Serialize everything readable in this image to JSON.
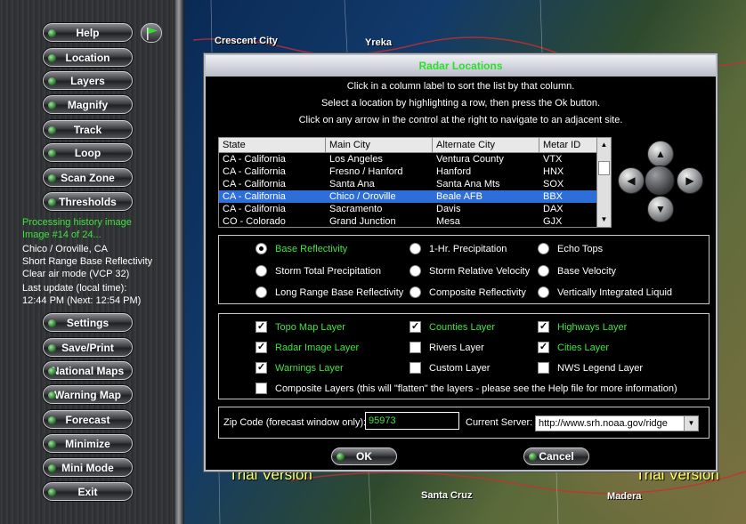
{
  "sidebar": {
    "buttons": [
      {
        "label": "Help"
      },
      {
        "label": "Location"
      },
      {
        "label": "Layers"
      },
      {
        "label": "Magnify"
      },
      {
        "label": "Track"
      },
      {
        "label": "Loop"
      },
      {
        "label": "Scan Zone"
      },
      {
        "label": "Thresholds"
      },
      {
        "label": "Settings"
      },
      {
        "label": "Save/Print"
      },
      {
        "label": "National Maps"
      },
      {
        "label": "Warning Map"
      },
      {
        "label": "Forecast"
      },
      {
        "label": "Minimize"
      },
      {
        "label": "Mini Mode"
      },
      {
        "label": "Exit"
      }
    ],
    "status": [
      "Processing history image",
      "Image #14 of 24...",
      "Chico / Oroville, CA",
      "Short Range Base Reflectivity",
      "Clear air mode (VCP 32)",
      "Last update (local time):",
      "12:44 PM (Next: 12:54 PM)"
    ]
  },
  "map": {
    "labels": [
      "Crescent City",
      "Yreka",
      "Santa Cruz",
      "Madera"
    ],
    "trial_left": "Trial Version",
    "trial_right": "Trial Version"
  },
  "dialog": {
    "title": "Radar Locations",
    "instructions": [
      "Click in a column label to sort the list by that column.",
      "Select a location by highlighting a row, then press the Ok button.",
      "Click on any arrow in the control at the right to navigate to an adjacent site."
    ],
    "table": {
      "headers": [
        "State",
        "Main City",
        "Alternate City",
        "Metar ID"
      ],
      "rows": [
        [
          "CA - California",
          "Los Angeles",
          "Ventura County",
          "VTX"
        ],
        [
          "CA - California",
          "Fresno / Hanford",
          "Hanford",
          "HNX"
        ],
        [
          "CA - California",
          "Santa Ana",
          "Santa Ana Mts",
          "SOX"
        ],
        [
          "CA - California",
          "Chico / Oroville",
          "Beale AFB",
          "BBX"
        ],
        [
          "CA - California",
          "Sacramento",
          "Davis",
          "DAX"
        ],
        [
          "CO - Colorado",
          "Grand Junction",
          "Mesa",
          "GJX"
        ]
      ],
      "selected_row": 3
    },
    "products": [
      "Base Reflectivity",
      "1-Hr. Precipitation",
      "Echo Tops",
      "Storm Total Precipitation",
      "Storm Relative Velocity",
      "Base Velocity",
      "Long Range Base Reflectivity",
      "Composite Reflectivity",
      "Vertically Integrated Liquid"
    ],
    "layers": [
      "Topo Map Layer",
      "Counties Layer",
      "Highways Layer",
      "Radar Image Layer",
      "Rivers Layer",
      "Cities Layer",
      "Warnings Layer",
      "Custom Layer",
      "NWS Legend Layer"
    ],
    "composite_label": "Composite Layers (this will \"flatten\" the layers - please see the Help file for more information)",
    "zip_label": "Zip Code (forecast window only):",
    "zip_value": "95973",
    "server_label": "Current Server:",
    "server_value": "http://www.srh.noaa.gov/ridge",
    "ok_label": "OK",
    "cancel_label": "Cancel"
  },
  "colors": {
    "accent_green": "#3ee43e",
    "selection": "#2d6ed8"
  }
}
